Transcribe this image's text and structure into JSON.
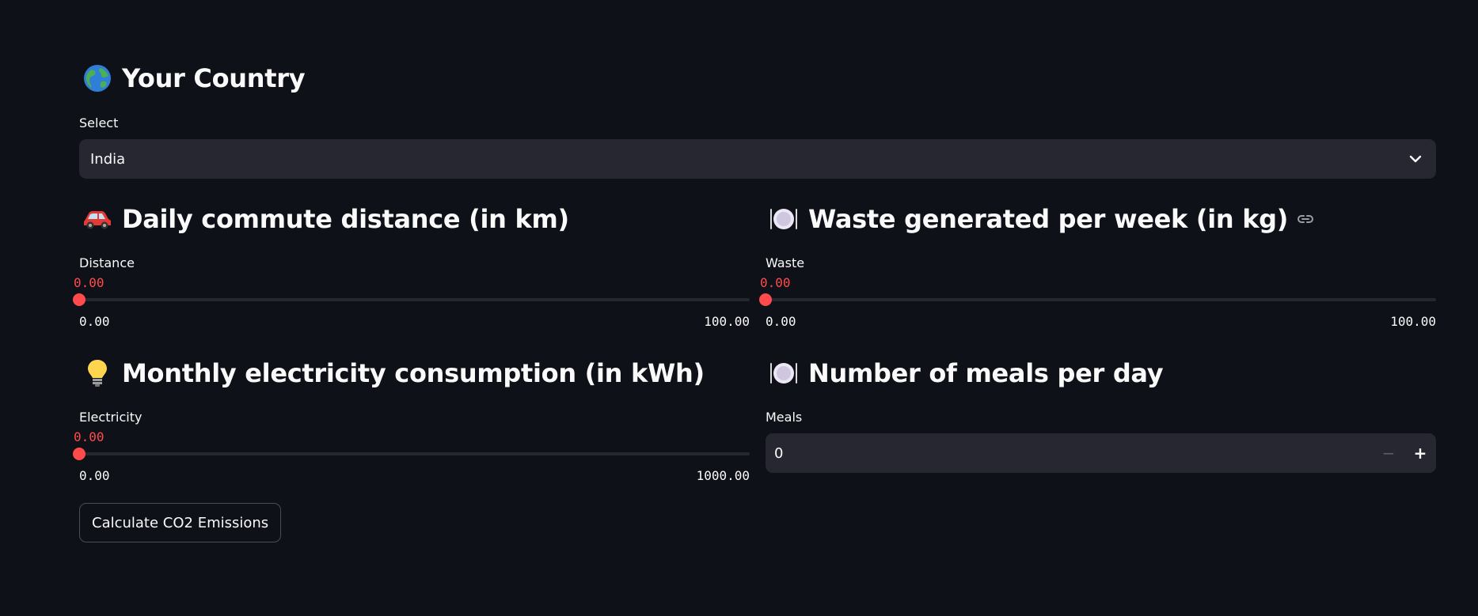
{
  "country": {
    "heading": "Your Country",
    "select_label": "Select",
    "selected": "India",
    "icon": "globe-icon"
  },
  "commute": {
    "heading": "Daily commute distance (in km)",
    "label": "Distance",
    "value": "0.00",
    "min": "0.00",
    "max": "100.00",
    "fraction": 0,
    "icon": "car-icon"
  },
  "waste": {
    "heading": "Waste generated per week (in kg)",
    "label": "Waste",
    "value": "0.00",
    "min": "0.00",
    "max": "100.00",
    "fraction": 0,
    "icon": "plate-icon"
  },
  "electricity": {
    "heading": "Monthly electricity consumption (in kWh)",
    "label": "Electricity",
    "value": "0.00",
    "min": "0.00",
    "max": "1000.00",
    "fraction": 0,
    "icon": "lightbulb-icon"
  },
  "meals": {
    "heading": "Number of meals per day",
    "label": "Meals",
    "value": "0",
    "minus": "−",
    "plus": "+",
    "icon": "plate-icon"
  },
  "calculate_button": "Calculate CO2 Emissions",
  "colors": {
    "background": "#0e1117",
    "accent": "#ff4b4b",
    "widget": "#262730",
    "text": "#fafafa"
  }
}
